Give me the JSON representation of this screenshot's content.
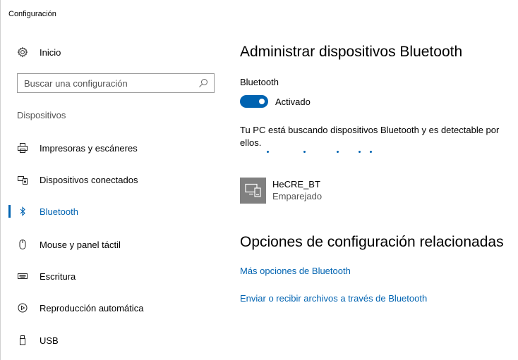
{
  "window": {
    "title": "Configuración"
  },
  "sidebar": {
    "home_label": "Inicio",
    "search_placeholder": "Buscar una configuración",
    "section_label": "Dispositivos",
    "items": [
      {
        "label": "Impresoras y escáneres",
        "icon": "printer-icon"
      },
      {
        "label": "Dispositivos conectados",
        "icon": "connected-devices-icon"
      },
      {
        "label": "Bluetooth",
        "icon": "bluetooth-icon",
        "active": true
      },
      {
        "label": "Mouse y panel táctil",
        "icon": "mouse-icon"
      },
      {
        "label": "Escritura",
        "icon": "keyboard-icon"
      },
      {
        "label": "Reproducción automática",
        "icon": "autoplay-icon"
      },
      {
        "label": "USB",
        "icon": "usb-icon"
      }
    ]
  },
  "main": {
    "title": "Administrar dispositivos Bluetooth",
    "bluetooth_label": "Bluetooth",
    "toggle_state": "Activado",
    "toggle_on": true,
    "searching_text": "Tu PC está buscando dispositivos Bluetooth y es detectable por ellos.",
    "devices": [
      {
        "name": "HeCRE_BT",
        "status": "Emparejado",
        "icon": "device-icon"
      }
    ],
    "related_title": "Opciones de configuración relacionadas",
    "related_links": [
      "Más opciones de Bluetooth",
      "Enviar o recibir archivos a través de Bluetooth"
    ]
  },
  "colors": {
    "accent": "#0063b1",
    "device_tile": "#808080"
  }
}
